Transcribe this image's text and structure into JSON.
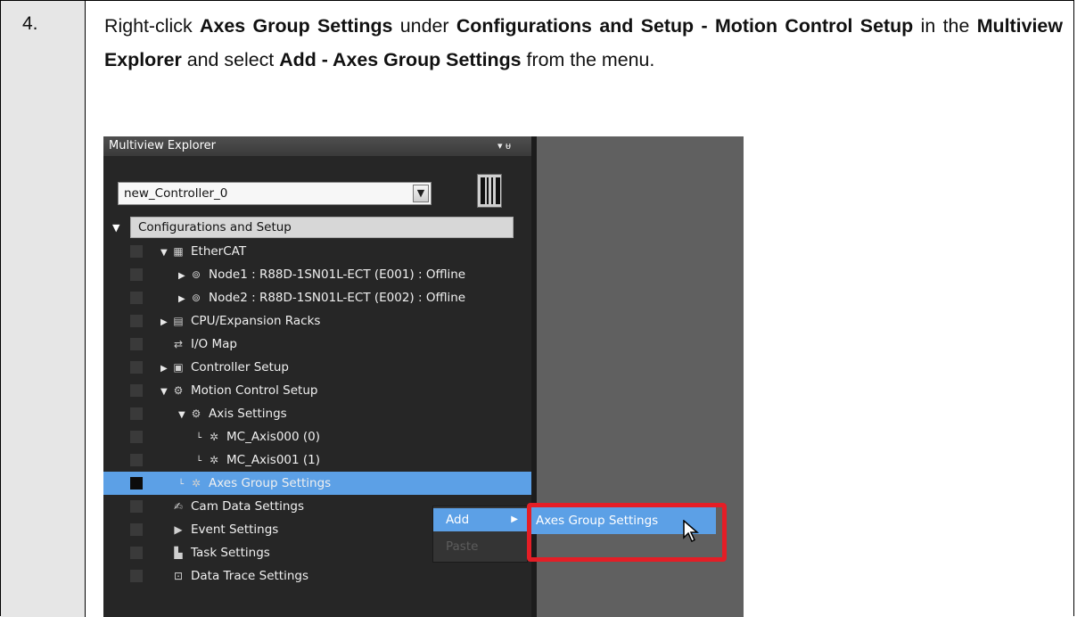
{
  "step": {
    "number": "4."
  },
  "instruction": {
    "parts": [
      {
        "text": "Right-click ",
        "bold": false
      },
      {
        "text": "Axes Group Settings",
        "bold": true
      },
      {
        "text": " under ",
        "bold": false
      },
      {
        "text": "Configurations and Setup - Motion Control Setup",
        "bold": true
      },
      {
        "text": " in the ",
        "bold": false
      },
      {
        "text": "Multiview Explorer",
        "bold": true
      },
      {
        "text": " and select ",
        "bold": false
      },
      {
        "text": "Add - Axes Group Settings",
        "bold": true
      },
      {
        "text": " from the menu.",
        "bold": false
      }
    ]
  },
  "panel": {
    "title": "Multiview Explorer",
    "pin_label": "▾ ᵾ",
    "controller": {
      "selected": "new_Controller_0"
    }
  },
  "tree": {
    "root": "Configurations and Setup",
    "items": [
      {
        "label": "EtherCAT",
        "arrow": "▼",
        "icon": "ethercat-icon",
        "glyph": "▦",
        "depth": 0
      },
      {
        "label": "Node1 : R88D-1SN01L-ECT (E001) : Offline",
        "arrow": "▶",
        "icon": "node-icon",
        "glyph": "⊚",
        "depth": 1
      },
      {
        "label": "Node2 : R88D-1SN01L-ECT (E002) : Offline",
        "arrow": "▶",
        "icon": "node-icon",
        "glyph": "⊚",
        "depth": 1
      },
      {
        "label": "CPU/Expansion Racks",
        "arrow": "▶",
        "icon": "rack-icon",
        "glyph": "▤",
        "depth": 0
      },
      {
        "label": "I/O Map",
        "arrow": "",
        "icon": "io-map-icon",
        "glyph": "⇄",
        "depth": 0
      },
      {
        "label": "Controller Setup",
        "arrow": "▶",
        "icon": "controller-setup-icon",
        "glyph": "▣",
        "depth": 0
      },
      {
        "label": "Motion Control Setup",
        "arrow": "▼",
        "icon": "motion-gear-icon",
        "glyph": "⚙",
        "depth": 0
      },
      {
        "label": "Axis Settings",
        "arrow": "▼",
        "icon": "axis-gear-icon",
        "glyph": "⚙",
        "depth": 1
      },
      {
        "label": "MC_Axis000 (0)",
        "arrow": "└",
        "icon": "axis-icon",
        "glyph": "✲",
        "depth": 2
      },
      {
        "label": "MC_Axis001 (1)",
        "arrow": "└",
        "icon": "axis-icon",
        "glyph": "✲",
        "depth": 2
      },
      {
        "label": "Axes Group Settings",
        "arrow": "└",
        "icon": "axes-group-icon",
        "glyph": "✲",
        "depth": 1,
        "selected": true
      },
      {
        "label": "Cam Data Settings",
        "arrow": "",
        "icon": "cam-data-icon",
        "glyph": "✍",
        "depth": 0
      },
      {
        "label": "Event Settings",
        "arrow": "",
        "icon": "event-icon",
        "glyph": "▶",
        "depth": 0
      },
      {
        "label": "Task Settings",
        "arrow": "",
        "icon": "task-icon",
        "glyph": "▙",
        "depth": 0
      },
      {
        "label": "Data Trace Settings",
        "arrow": "",
        "icon": "data-trace-icon",
        "glyph": "⊡",
        "depth": 0
      }
    ]
  },
  "context_menu": {
    "items": [
      {
        "label": "Add",
        "enabled": true,
        "has_submenu": true
      },
      {
        "label": "Paste",
        "enabled": false
      }
    ],
    "submenu": {
      "label": "Axes Group Settings"
    }
  },
  "colors": {
    "highlight_border": "#e41e26",
    "selection": "#5ca0e6",
    "panel_bg": "#262626"
  }
}
